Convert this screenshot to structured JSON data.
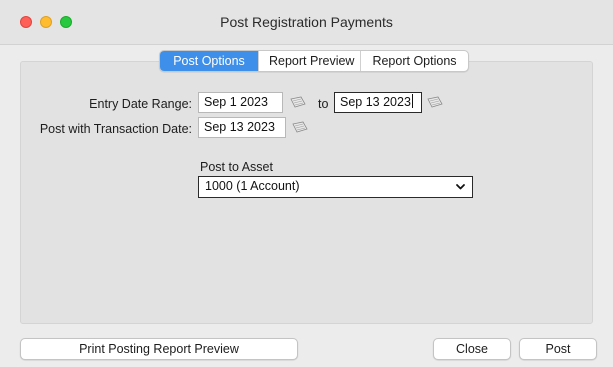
{
  "window": {
    "title": "Post Registration Payments"
  },
  "tabs": [
    {
      "label": "Post Options",
      "active": true
    },
    {
      "label": "Report Preview",
      "active": false
    },
    {
      "label": "Report Options",
      "active": false
    }
  ],
  "form": {
    "entry_date_label": "Entry Date Range:",
    "entry_date_from": "Sep 1 2023",
    "to_label": "to",
    "entry_date_to": "Sep 13 2023",
    "post_date_label": "Post with Transaction Date:",
    "post_date": "Sep 13 2023",
    "asset_label": "Post to Asset",
    "asset_selected": "1000 (1 Account)"
  },
  "buttons": {
    "print_preview": "Print Posting Report Preview",
    "close": "Close",
    "post": "Post"
  },
  "colors": {
    "tab_active": "#3d8fea",
    "close_light": "#fe5f57",
    "minimize_light": "#febc2e",
    "zoom_light": "#28c840"
  },
  "icons": {
    "calendar": "calendar-icon",
    "dropdown": "chevron-down-icon"
  }
}
